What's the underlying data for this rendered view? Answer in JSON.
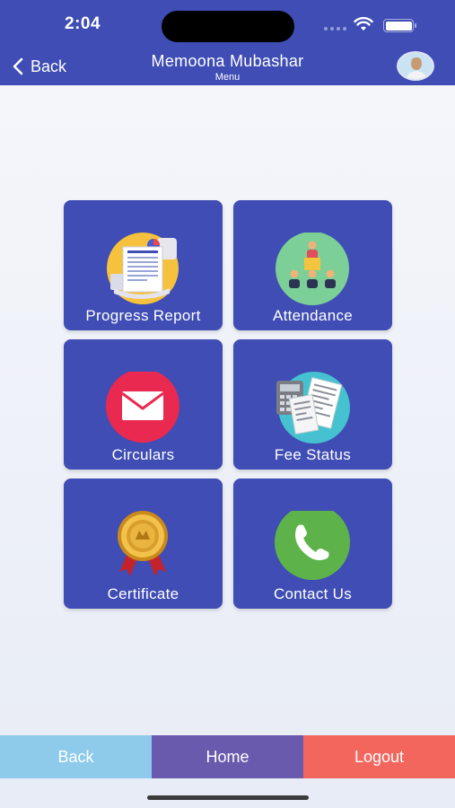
{
  "status_bar": {
    "time": "2:04"
  },
  "header": {
    "back_label": "Back",
    "title": "Memoona Mubashar",
    "subtitle": "Menu"
  },
  "menu": {
    "items": [
      {
        "label": "Progress Report",
        "icon": "progress-report-icon"
      },
      {
        "label": "Attendance",
        "icon": "attendance-icon"
      },
      {
        "label": "Circulars",
        "icon": "envelope-icon"
      },
      {
        "label": "Fee Status",
        "icon": "fee-status-icon"
      },
      {
        "label": "Certificate",
        "icon": "medal-icon"
      },
      {
        "label": "Contact Us",
        "icon": "phone-icon"
      }
    ]
  },
  "bottom_bar": {
    "back_label": "Back",
    "home_label": "Home",
    "logout_label": "Logout"
  },
  "colors": {
    "header": "#3f4db4",
    "tile": "#3f4db4",
    "back_button": "#8ecbeb",
    "home_button": "#6a5aae",
    "logout_button": "#f2665e"
  }
}
